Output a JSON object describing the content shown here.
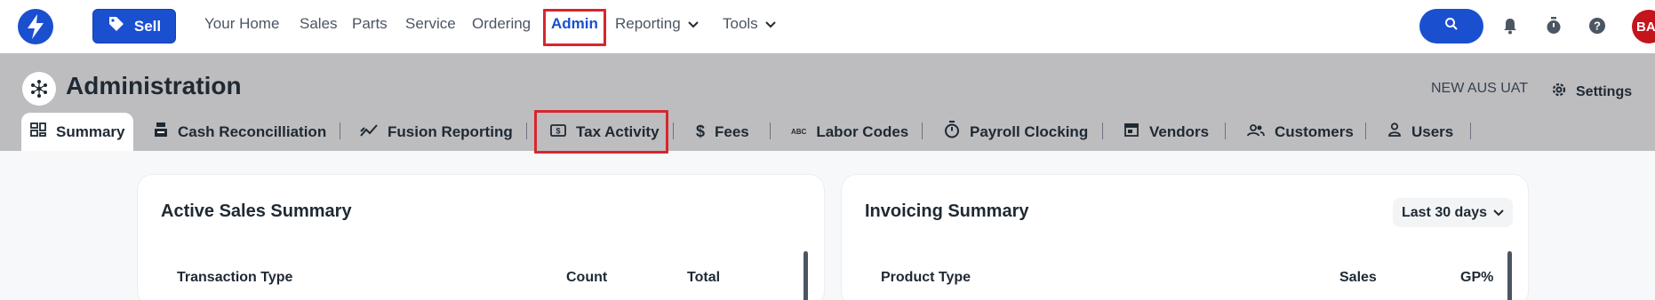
{
  "topnav": {
    "sell_label": "Sell",
    "items": [
      {
        "label": "Your Home"
      },
      {
        "label": "Sales"
      },
      {
        "label": "Parts"
      },
      {
        "label": "Service"
      },
      {
        "label": "Ordering"
      },
      {
        "label": "Admin",
        "active": true
      },
      {
        "label": "Reporting",
        "has_dropdown": true
      },
      {
        "label": "Tools",
        "has_dropdown": true
      }
    ],
    "avatar_initials": "BA",
    "icons": [
      "lightning-logo-icon",
      "tag-icon",
      "search-icon",
      "bell-icon",
      "timer-icon",
      "help-icon"
    ]
  },
  "header": {
    "title": "Administration",
    "environment": "NEW AUS UAT",
    "settings_label": "Settings"
  },
  "tabs": [
    {
      "label": "Summary",
      "icon": "dashboard-icon",
      "active": true
    },
    {
      "label": "Cash Reconcilliation",
      "icon": "cash-register-icon"
    },
    {
      "label": "Fusion Reporting",
      "icon": "trend-chart-icon"
    },
    {
      "label": "Tax Activity",
      "icon": "money-icon",
      "highlighted": true
    },
    {
      "label": "Fees",
      "icon": "dollar-icon"
    },
    {
      "label": "Labor Codes",
      "icon": "abc-icon"
    },
    {
      "label": "Payroll Clocking",
      "icon": "stopwatch-icon"
    },
    {
      "label": "Vendors",
      "icon": "store-icon"
    },
    {
      "label": "Customers",
      "icon": "people-icon"
    },
    {
      "label": "Users",
      "icon": "person-icon"
    }
  ],
  "active_sales": {
    "title": "Active Sales Summary",
    "columns": [
      "Transaction Type",
      "Count",
      "Total"
    ]
  },
  "invoicing": {
    "title": "Invoicing Summary",
    "range_label": "Last 30 days",
    "columns": [
      "Product Type",
      "Sales",
      "GP%"
    ]
  },
  "colors": {
    "brand_blue": "#1a4fd0",
    "highlight_red": "#d7262e",
    "band_gray": "#bdbdbf",
    "avatar_red": "#c4141c"
  }
}
